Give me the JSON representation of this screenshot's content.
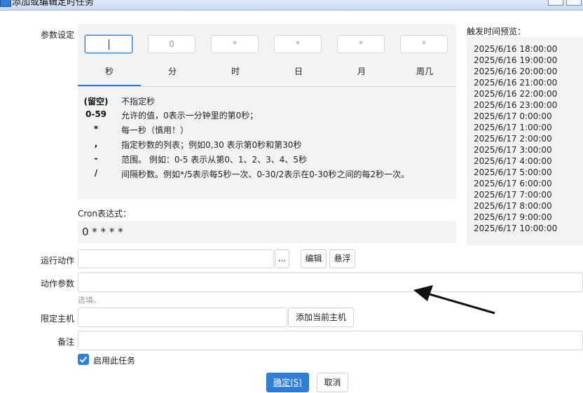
{
  "window": {
    "title": "添加或编辑定时任务"
  },
  "labels": {
    "params": "参数设定",
    "action": "运行动作",
    "action_params": "动作参数",
    "host": "限定主机",
    "remark": "备注",
    "cron_expr_label": "Cron表达式：",
    "preview_title": "触发时间预览："
  },
  "cron_fields": {
    "second": "",
    "minute": "0",
    "hour": "*",
    "day": "*",
    "month": "*",
    "weekday": "*"
  },
  "tabs": [
    "秒",
    "分",
    "时",
    "日",
    "月",
    "周几"
  ],
  "active_tab": "秒",
  "help": [
    {
      "symbol": "(留空)",
      "desc": "不指定秒"
    },
    {
      "symbol": "0-59",
      "desc": "允许的值，0表示一分钟里的第0秒；"
    },
    {
      "symbol": "*",
      "desc": "每一秒（慎用！）"
    },
    {
      "symbol": ",",
      "desc": "指定秒数的列表；例如0,30 表示第0秒和第30秒"
    },
    {
      "symbol": "-",
      "desc": "范围。 例如：0-5 表示从第0、1、2、3、4、5秒"
    },
    {
      "symbol": "/",
      "desc": "间隔秒数。例如*/5表示每5秒一次、0-30/2表示在0-30秒之间的每2秒一次。"
    }
  ],
  "cron_expression": "0 * * * *",
  "preview": [
    "2025/6/16 18:00:00",
    "2025/6/16 19:00:00",
    "2025/6/16 20:00:00",
    "2025/6/16 21:00:00",
    "2025/6/16 22:00:00",
    "2025/6/16 23:00:00",
    "2025/6/17 0:00:00",
    "2025/6/17 1:00:00",
    "2025/6/17 2:00:00",
    "2025/6/17 3:00:00",
    "2025/6/17 4:00:00",
    "2025/6/17 5:00:00",
    "2025/6/17 6:00:00",
    "2025/6/17 7:00:00",
    "2025/6/17 8:00:00",
    "2025/6/17 9:00:00",
    "2025/6/17 10:00:00"
  ],
  "inputs": {
    "action_value": "",
    "action_params_value": "",
    "host_value": "",
    "remark_value": ""
  },
  "buttons": {
    "browse": "...",
    "edit": "编辑",
    "float": "悬浮",
    "add_current_host": "添加当前主机",
    "ok": "确定(S)",
    "cancel": "取消"
  },
  "hint_text": "选填。",
  "enable_label": "启用此任务",
  "enable_checked": true,
  "colors": {
    "accent": "#2f7fd6",
    "panel_bg": "#f3f3f3"
  }
}
